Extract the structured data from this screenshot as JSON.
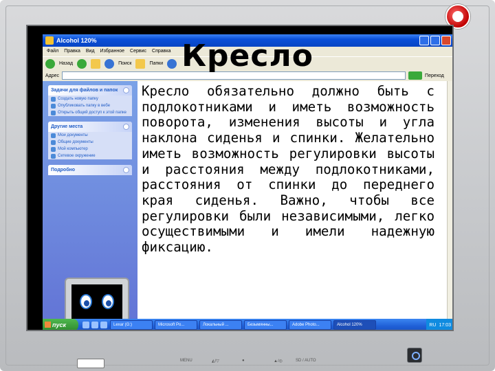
{
  "window": {
    "title": "Alcohol 120%",
    "menu": [
      "Файл",
      "Правка",
      "Вид",
      "Избранное",
      "Сервис",
      "Справка"
    ],
    "toolbar": {
      "back": "Назад",
      "search": "Поиск",
      "folders": "Папки"
    },
    "address_label": "Адрес",
    "go_label": "Переход"
  },
  "task_pane": {
    "panels": [
      {
        "title": "Задачи для файлов и папок",
        "items": [
          "Создать новую папку",
          "Опубликовать папку в вебе",
          "Открыть общий доступ к этой папке"
        ]
      },
      {
        "title": "Другие места",
        "items": [
          "Мои документы",
          "Общие документы",
          "Мой компьютер",
          "Сетевое окружение"
        ]
      },
      {
        "title": "Подробно",
        "items": []
      }
    ]
  },
  "slide": {
    "title": "Кресло",
    "body": "Кресло обязательно должно быть с подлокотниками и иметь возможность поворота, изменения высоты и угла наклона сиденья и спинки. Желательно иметь возможность регулировки высоты и расстояния между подлокотниками, расстояния от спинки до переднего края сиденья. Важно, чтобы все регулировки были независимыми, легко осуществимыми и имели надежную фиксацию."
  },
  "taskbar": {
    "start_label": "пуск",
    "tasks": [
      "Lexar (G:)",
      "Microsoft Po...",
      "Локальный ...",
      "Безымянны...",
      "Adobe Photo...",
      "Alcohol 120%"
    ],
    "lang": "RU",
    "clock": "17:03"
  },
  "bezel": {
    "menu_label": "MENU",
    "auto_label": "SD / AUTO",
    "colors": {
      "bezel": "#c7c9cc",
      "xp_blue": "#0845c4",
      "taskpane": "#6375d6"
    }
  }
}
